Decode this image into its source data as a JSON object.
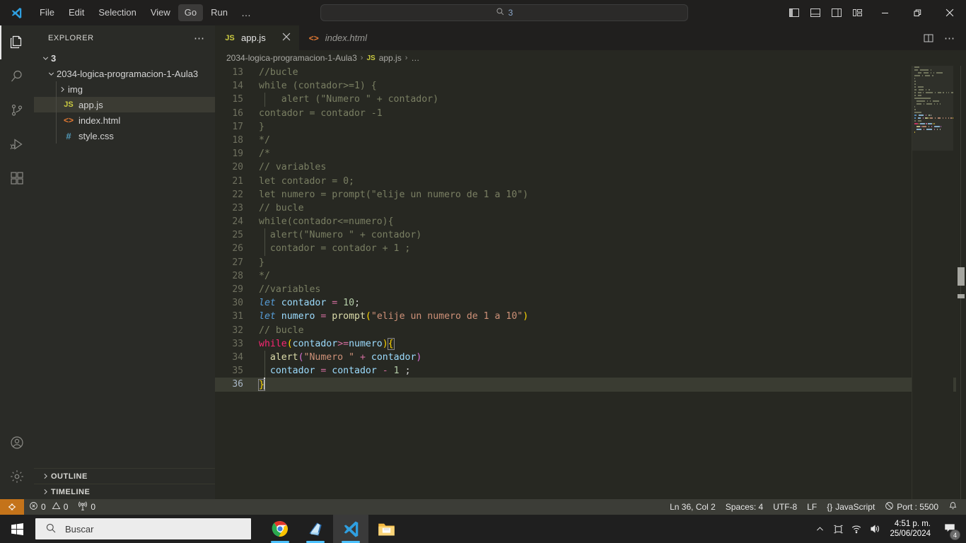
{
  "titlebar": {
    "menu": [
      "File",
      "Edit",
      "Selection",
      "View",
      "Go",
      "Run"
    ],
    "menu_active": "Go",
    "menu_more": "…",
    "search_value": "3",
    "search_icon": "search-icon",
    "nav_back_icon": "arrow-left-icon",
    "nav_forward_icon": "arrow-right-icon",
    "layout_icons": [
      "toggle-primary-sidebar-icon",
      "toggle-panel-icon",
      "toggle-secondary-sidebar-icon",
      "customize-layout-icon"
    ],
    "window_controls": [
      "minimize",
      "restore",
      "close"
    ]
  },
  "activitybar": {
    "items": [
      {
        "name": "explorer",
        "icon": "files-icon",
        "active": true
      },
      {
        "name": "search",
        "icon": "search-icon",
        "active": false
      },
      {
        "name": "source-control",
        "icon": "source-control-icon",
        "active": false
      },
      {
        "name": "run-and-debug",
        "icon": "run-debug-icon",
        "active": false
      },
      {
        "name": "extensions",
        "icon": "extensions-icon",
        "active": false
      }
    ],
    "bottom": [
      {
        "name": "accounts",
        "icon": "account-icon"
      },
      {
        "name": "settings",
        "icon": "gear-icon"
      }
    ]
  },
  "sidebar": {
    "title": "EXPLORER",
    "more_actions": "⋯",
    "root_label": "3",
    "tree": [
      {
        "label": "2034-logica-programacion-1-Aula3",
        "type": "folder",
        "expanded": true,
        "depth": 1
      },
      {
        "label": "img",
        "type": "folder",
        "expanded": false,
        "depth": 2
      },
      {
        "label": "app.js",
        "type": "js",
        "depth": 2,
        "selected": true
      },
      {
        "label": "index.html",
        "type": "html",
        "depth": 2
      },
      {
        "label": "style.css",
        "type": "css",
        "depth": 2
      }
    ],
    "sections": [
      "OUTLINE",
      "TIMELINE"
    ]
  },
  "editor": {
    "tabs": [
      {
        "label": "app.js",
        "icon": "js-file-icon",
        "active": true,
        "italic": false,
        "closable": true
      },
      {
        "label": "index.html",
        "icon": "html-file-icon",
        "active": false,
        "italic": true,
        "closable": false
      }
    ],
    "tab_actions": [
      "split-editor-right-icon",
      "more-actions-icon"
    ],
    "breadcrumb": [
      "2034-logica-programacion-1-Aula3",
      "app.js",
      "…"
    ],
    "breadcrumb_separator": "›",
    "lines": [
      {
        "n": 13,
        "tokens": [
          {
            "t": "//bucle",
            "c": "t-com"
          }
        ]
      },
      {
        "n": 14,
        "tokens": [
          {
            "t": "while (contador>=1) {",
            "c": "t-com"
          }
        ]
      },
      {
        "n": 15,
        "tokens": [
          {
            "t": "    alert (\"Numero \" + contador)",
            "c": "t-com"
          }
        ],
        "guide": true
      },
      {
        "n": 16,
        "tokens": [
          {
            "t": "contador = contador -1",
            "c": "t-com"
          }
        ]
      },
      {
        "n": 17,
        "tokens": [
          {
            "t": "}",
            "c": "t-com"
          }
        ]
      },
      {
        "n": 18,
        "tokens": [
          {
            "t": "*/",
            "c": "t-com"
          }
        ]
      },
      {
        "n": 19,
        "tokens": [
          {
            "t": "/*",
            "c": "t-com"
          }
        ]
      },
      {
        "n": 20,
        "tokens": [
          {
            "t": "// variables",
            "c": "t-com"
          }
        ]
      },
      {
        "n": 21,
        "tokens": [
          {
            "t": "let contador = 0;",
            "c": "t-com"
          }
        ]
      },
      {
        "n": 22,
        "tokens": [
          {
            "t": "let numero = prompt(\"elije un numero de 1 a 10\")",
            "c": "t-com"
          }
        ]
      },
      {
        "n": 23,
        "tokens": [
          {
            "t": "// bucle",
            "c": "t-com"
          }
        ]
      },
      {
        "n": 24,
        "tokens": [
          {
            "t": "while(contador<=numero){",
            "c": "t-com"
          }
        ]
      },
      {
        "n": 25,
        "tokens": [
          {
            "t": "  alert(\"Numero \" + contador)",
            "c": "t-com"
          }
        ],
        "guide": true
      },
      {
        "n": 26,
        "tokens": [
          {
            "t": "  contador = contador + 1 ;",
            "c": "t-com"
          }
        ],
        "guide": true
      },
      {
        "n": 27,
        "tokens": [
          {
            "t": "}",
            "c": "t-com"
          }
        ]
      },
      {
        "n": 28,
        "tokens": [
          {
            "t": "*/",
            "c": "t-com"
          }
        ]
      },
      {
        "n": 29,
        "tokens": [
          {
            "t": "//variables",
            "c": "t-com"
          }
        ]
      },
      {
        "n": 30,
        "tokens": [
          {
            "t": "let",
            "c": "t-kw"
          },
          {
            "t": " ",
            "c": "t-plain"
          },
          {
            "t": "contador",
            "c": "t-var"
          },
          {
            "t": " ",
            "c": "t-plain"
          },
          {
            "t": "=",
            "c": "t-op"
          },
          {
            "t": " ",
            "c": "t-plain"
          },
          {
            "t": "10",
            "c": "t-num"
          },
          {
            "t": ";",
            "c": "t-plain"
          }
        ]
      },
      {
        "n": 31,
        "tokens": [
          {
            "t": "let",
            "c": "t-kw"
          },
          {
            "t": " ",
            "c": "t-plain"
          },
          {
            "t": "numero",
            "c": "t-var"
          },
          {
            "t": " ",
            "c": "t-plain"
          },
          {
            "t": "=",
            "c": "t-op"
          },
          {
            "t": " ",
            "c": "t-plain"
          },
          {
            "t": "prompt",
            "c": "t-fn"
          },
          {
            "t": "(",
            "c": "t-b1"
          },
          {
            "t": "\"elije un numero de 1 a 10\"",
            "c": "t-str"
          },
          {
            "t": ")",
            "c": "t-b1"
          }
        ]
      },
      {
        "n": 32,
        "tokens": [
          {
            "t": "// bucle",
            "c": "t-com"
          }
        ]
      },
      {
        "n": 33,
        "tokens": [
          {
            "t": "while",
            "c": "t-ctl"
          },
          {
            "t": "(",
            "c": "t-b1"
          },
          {
            "t": "contador",
            "c": "t-var"
          },
          {
            "t": ">=",
            "c": "t-op"
          },
          {
            "t": "numero",
            "c": "t-var"
          },
          {
            "t": ")",
            "c": "t-b1"
          },
          {
            "t": "{",
            "c": "t-b1",
            "match": true
          }
        ]
      },
      {
        "n": 34,
        "guide": true,
        "tokens": [
          {
            "t": "  ",
            "c": "t-plain"
          },
          {
            "t": "alert",
            "c": "t-fn"
          },
          {
            "t": "(",
            "c": "t-b2"
          },
          {
            "t": "\"Numero \"",
            "c": "t-str"
          },
          {
            "t": " ",
            "c": "t-plain"
          },
          {
            "t": "+",
            "c": "t-op"
          },
          {
            "t": " ",
            "c": "t-plain"
          },
          {
            "t": "contador",
            "c": "t-var"
          },
          {
            "t": ")",
            "c": "t-b2"
          }
        ]
      },
      {
        "n": 35,
        "guide": true,
        "tokens": [
          {
            "t": "  ",
            "c": "t-plain"
          },
          {
            "t": "contador",
            "c": "t-var"
          },
          {
            "t": " ",
            "c": "t-plain"
          },
          {
            "t": "=",
            "c": "t-op"
          },
          {
            "t": " ",
            "c": "t-plain"
          },
          {
            "t": "contador",
            "c": "t-var"
          },
          {
            "t": " ",
            "c": "t-plain"
          },
          {
            "t": "-",
            "c": "t-op"
          },
          {
            "t": " ",
            "c": "t-plain"
          },
          {
            "t": "1",
            "c": "t-num"
          },
          {
            "t": " ;",
            "c": "t-plain"
          }
        ]
      },
      {
        "n": 36,
        "current": true,
        "cursor": true,
        "tokens": [
          {
            "t": "}",
            "c": "t-b1",
            "match": true
          }
        ]
      }
    ]
  },
  "statusbar": {
    "remote_icon": "remote-window-icon",
    "errors_icon": "error-icon",
    "errors": "0",
    "warnings_icon": "warning-icon",
    "warnings": "0",
    "ports_icon": "radio-tower-icon",
    "ports": "0",
    "cursor_position": "Ln 36, Col 2",
    "indentation": "Spaces: 4",
    "encoding": "UTF-8",
    "eol": "LF",
    "language_icon": "{}",
    "language": "JavaScript",
    "live_server_icon": "circle-slash-icon",
    "live_server": "Port : 5500",
    "bell_icon": "bell-icon"
  },
  "taskbar": {
    "start_icon": "windows-start-icon",
    "search_icon": "search-icon",
    "search_placeholder": "Buscar",
    "apps": [
      {
        "name": "google-chrome",
        "running": true,
        "active": false
      },
      {
        "name": "microsoft-edge",
        "running": true,
        "active": false
      },
      {
        "name": "visual-studio-code",
        "running": true,
        "active": true
      },
      {
        "name": "file-explorer",
        "running": false,
        "active": false
      }
    ],
    "tray_icons": [
      "chevron-up-icon",
      "screen-record-icon",
      "wifi-icon",
      "volume-icon"
    ],
    "time": "4:51 p. m.",
    "date": "25/06/2024",
    "notifications_icon": "notification-icon",
    "notifications_count": "4"
  },
  "colors": {
    "accent": "#0078d4",
    "editor_bg": "#272822",
    "titlebar_bg": "#201f1e",
    "sidebar_bg": "#2a2b27",
    "statusbar_bg": "#3c3d37",
    "remote_bg": "#c4731a",
    "current_line": "#3a3c32"
  }
}
